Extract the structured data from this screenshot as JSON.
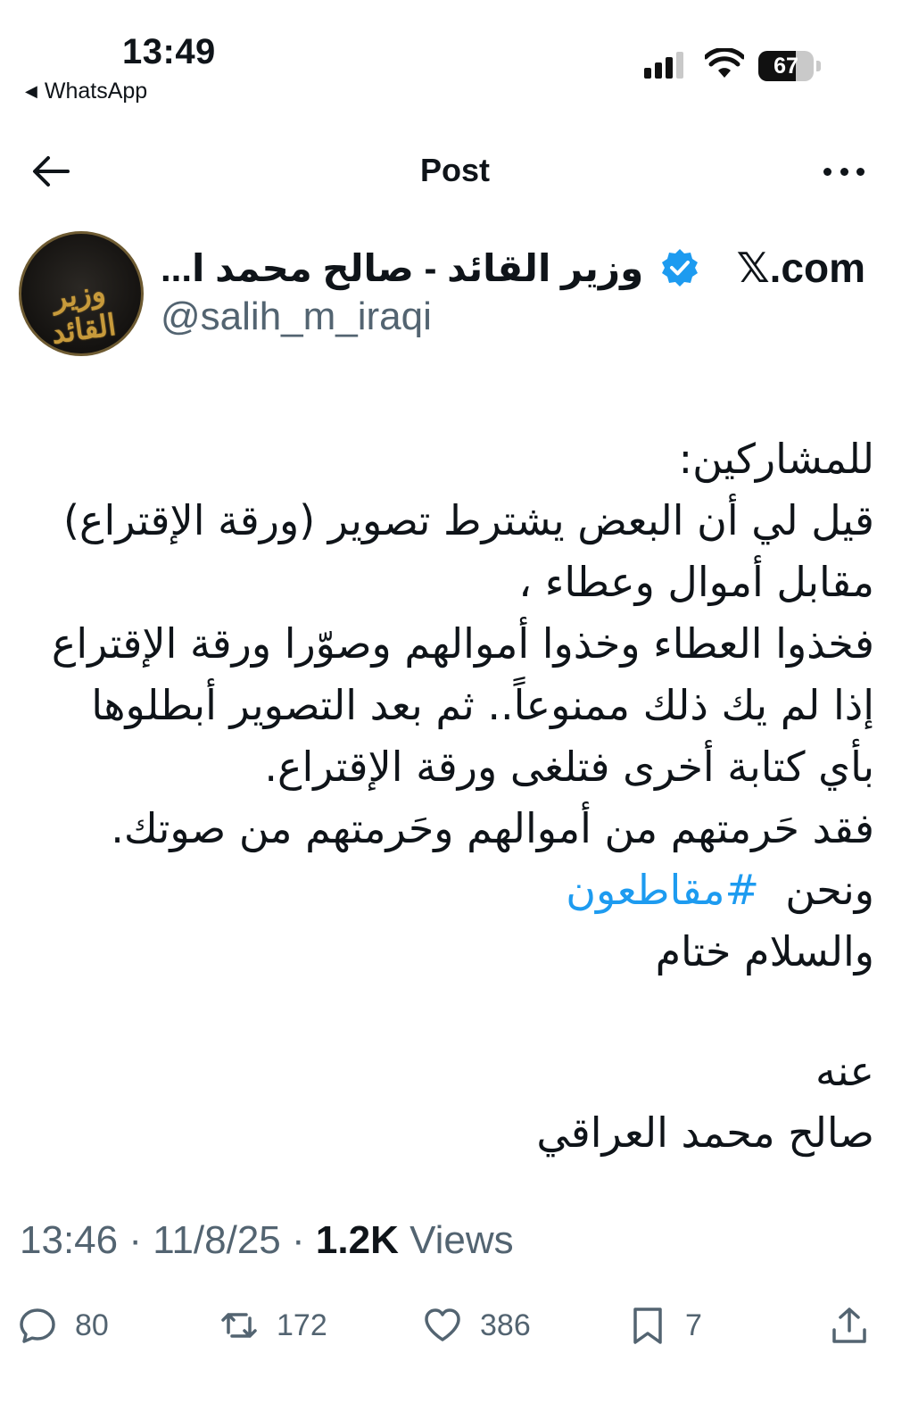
{
  "status_bar": {
    "time": "13:49",
    "back_app": "WhatsApp",
    "battery_percent": "67",
    "battery_level": 0.67,
    "icons": [
      "signal-icon",
      "wifi-icon",
      "battery-icon"
    ]
  },
  "nav": {
    "title": "Post",
    "back_icon": "arrow-left-icon",
    "more_icon": "more-horizontal-icon"
  },
  "author": {
    "name": "وزير القائد - صالح محمد ا...",
    "site": "𝕏.com",
    "handle": "@salih_m_iraqi",
    "avatar_text": "وزير القائد",
    "verified_color": "#1d9bf0"
  },
  "post": {
    "lines": [
      "للمشاركين:",
      "قيل لي أن البعض يشترط تصوير (ورقة الإقتراع)",
      "مقابل أموال وعطاء ،",
      "فخذوا العطاء وخذوا أموالهم وصوّرا ورقة الإقتراع",
      "إذا لم يك ذلك ممنوعاً.. ثم بعد التصوير أبطلوها",
      "بأي كتابة أخرى فتلغى ورقة الإقتراع.",
      "فقد حَرمتهم من أموالهم وحَرمتهم من صوتك."
    ],
    "line_we": "ونحن",
    "hashtag": "#مقاطعون",
    "closing": "والسلام ختام",
    "signature_lines": [
      "عنه",
      "صالح محمد العراقي"
    ],
    "hashtag_color": "#1d9bf0"
  },
  "meta": {
    "time": "13:46",
    "date": "11/8/25",
    "sep": "·",
    "views_count": "1.2K",
    "views_label": "Views"
  },
  "actions": {
    "replies": "80",
    "reposts": "172",
    "likes": "386",
    "bookmarks": "7"
  }
}
